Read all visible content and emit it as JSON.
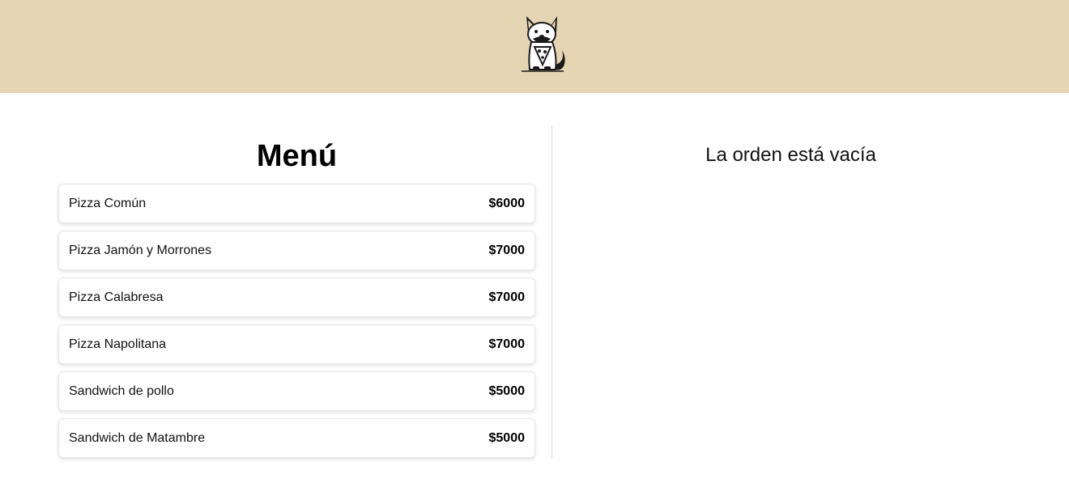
{
  "header": {
    "logo_icon": "dog-pizza-logo-icon",
    "background": "#e5d5b2"
  },
  "menu": {
    "title": "Menú",
    "items": [
      {
        "name": "Pizza Común",
        "price": "$6000"
      },
      {
        "name": "Pizza Jamón y Morrones",
        "price": "$7000"
      },
      {
        "name": "Pizza Calabresa",
        "price": "$7000"
      },
      {
        "name": "Pizza Napolitana",
        "price": "$7000"
      },
      {
        "name": "Sandwich de pollo",
        "price": "$5000"
      },
      {
        "name": "Sandwich de Matambre",
        "price": "$5000"
      }
    ]
  },
  "order": {
    "empty_message": "La orden está vacía"
  }
}
